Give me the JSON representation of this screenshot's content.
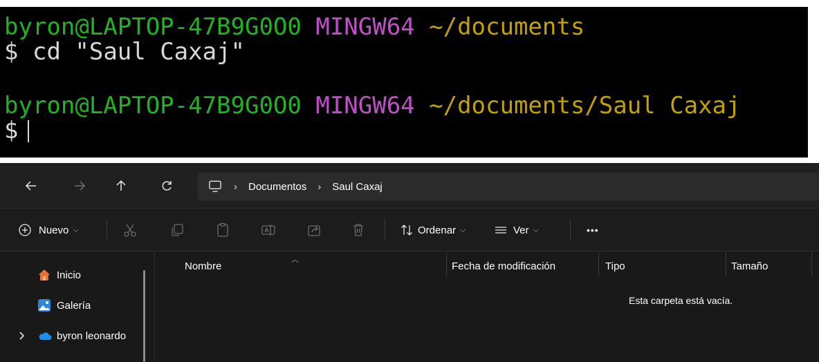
{
  "terminal": {
    "lines": [
      {
        "user": "byron@LAPTOP-47B9G0O0",
        "env": "MINGW64",
        "path": "~/documents"
      },
      {
        "prompt": "$",
        "command": "cd \"Saul Caxaj\""
      },
      {
        "user": "byron@LAPTOP-47B9G0O0",
        "env": "MINGW64",
        "path": "~/documents/Saul Caxaj"
      },
      {
        "prompt": "$",
        "command": ""
      }
    ]
  },
  "explorer": {
    "nav": {
      "back_icon": "arrow-left-icon",
      "forward_icon": "arrow-right-icon",
      "up_icon": "arrow-up-icon",
      "refresh_icon": "refresh-icon"
    },
    "breadcrumb": [
      "Documentos",
      "Saul Caxaj"
    ],
    "toolbar": {
      "new_label": "Nuevo",
      "sort_label": "Ordenar",
      "view_label": "Ver",
      "more_label": "•••"
    },
    "sidebar": {
      "items": [
        {
          "label": "Inicio",
          "icon": "home-icon"
        },
        {
          "label": "Galería",
          "icon": "gallery-icon"
        },
        {
          "label": "byron leonardo",
          "icon": "onedrive-cloud-icon"
        }
      ]
    },
    "columns": [
      "Nombre",
      "Fecha de modificación",
      "Tipo",
      "Tamaño"
    ],
    "empty_message": "Esta carpeta está vacía.",
    "colors": {
      "terminal_bg": "#000000",
      "user": "#21b321",
      "env": "#c04fc9",
      "path": "#c4a000",
      "explorer_bg": "#191919"
    }
  }
}
